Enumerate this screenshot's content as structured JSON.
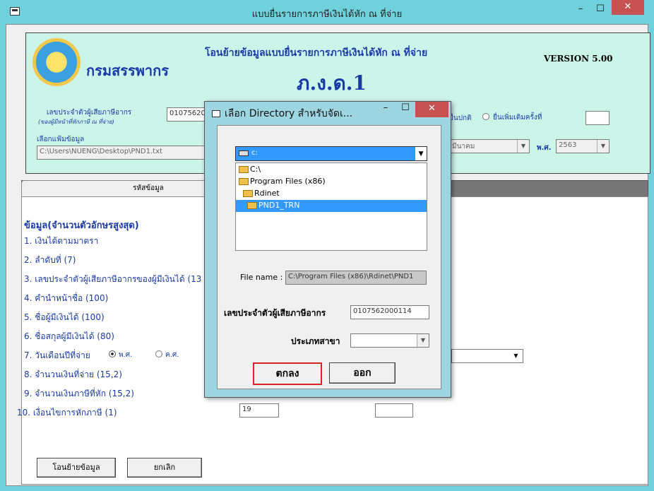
{
  "window": {
    "title": "แบบยื่นรายการภาษีเงินได้หัก ณ ที่จ่าย",
    "minimize": "–",
    "maximize": "☐",
    "close": "✕"
  },
  "banner": {
    "department": "กรมสรรพากร",
    "title": "โอนย้ายข้อมูลแบบยื่นรายการภาษีเงินได้หัก ณ ที่จ่าย",
    "form_code": "ภ.ง.ด.1",
    "version": "VERSION 5.00"
  },
  "topform": {
    "taxid_label": "เลขประจำตัวผู้เสียภาษีอากร",
    "taxid_sublabel": "(ของผู้มีหน้าที่หักภาษี ณ ที่จ่าย)",
    "taxid_value": "01075620",
    "file_label": "เลือกแฟ้มข้อมูล",
    "file_value": "C:\\Users\\NUENG\\Desktop\\PND1.txt",
    "normal_label": "ยื่นปกติ",
    "extra_label": "ยื่นเพิ่มเติมครั้งที่",
    "month_value": "มีนาคม",
    "year_label": "พ.ศ.",
    "year_value": "2563"
  },
  "tab": {
    "label": "รหัสข้อมูล"
  },
  "panel": {
    "section_title": "ข้อมูล(จำนวนตัวอักษรสูงสุด)",
    "items": [
      "1. เงินได้ตามมาตรา",
      "2. ลำดับที่ (7)",
      "3. เลขประจำตัวผู้เสียภาษีอากรของผู้มีเงินได้ (13",
      "4. คำนำหน้าชื่อ (100)",
      "5. ชื่อผู้มีเงินได้ (100)",
      "6. ชื่อสกุลผู้มีเงินได้ (80)",
      "7. วันเดือนปีที่จ่าย",
      "8. จำนวนเงินที่จ่าย (15,2)",
      "9. จำนวนเงินภาษีที่หัก (15,2)",
      "10. เงื่อนไขการหักภาษี (1)"
    ],
    "date_opt1": "พ.ศ.",
    "date_opt2": "ค.ศ.",
    "field10_value": "19",
    "transfer_button": "โอนย้ายข้อมูล",
    "cancel_button": "ยกเลิก"
  },
  "dialog": {
    "title": "เลือก Directory สำหรับจัดเ...",
    "drive": "c:",
    "directories": [
      "C:\\",
      "Program Files (x86)",
      "Rdinet",
      "PND1_TRN"
    ],
    "filename_label": "File name :",
    "filename_value": "C:\\Program Files (x86)\\Rdinet\\PND1",
    "taxid_label": "เลขประจำตัวผู้เสียภาษีอากร",
    "taxid_value": "0107562000114",
    "branch_label": "ประเภทสาขา",
    "ok_button": "ตกลง",
    "cancel_button": "ออก"
  }
}
